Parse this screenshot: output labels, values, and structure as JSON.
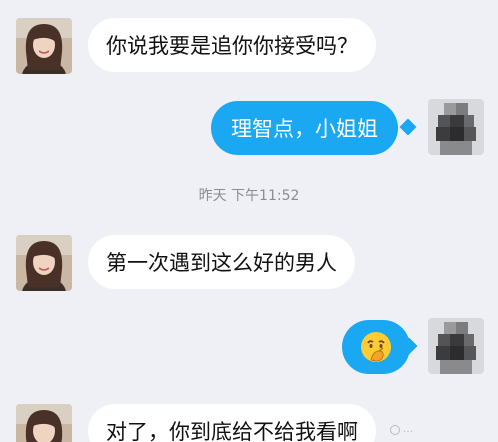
{
  "messages": [
    {
      "side": "in",
      "text": "你说我要是追你你接受吗？"
    },
    {
      "side": "out",
      "text": "理智点，小姐姐"
    },
    {
      "side": "in",
      "text": "第一次遇到这么好的男人"
    },
    {
      "side": "out",
      "text": "",
      "emoji": "thinking-hand-emoji"
    },
    {
      "side": "in",
      "text": "对了，你到底给不给我看啊"
    }
  ],
  "timestamp": "昨天  下午11:52",
  "colors": {
    "background": "#eef0f5",
    "incoming_bubble": "#ffffff",
    "outgoing_bubble": "#1aa8f2",
    "timestamp_text": "#8a8d93"
  },
  "watermark": {
    "text": "…"
  }
}
